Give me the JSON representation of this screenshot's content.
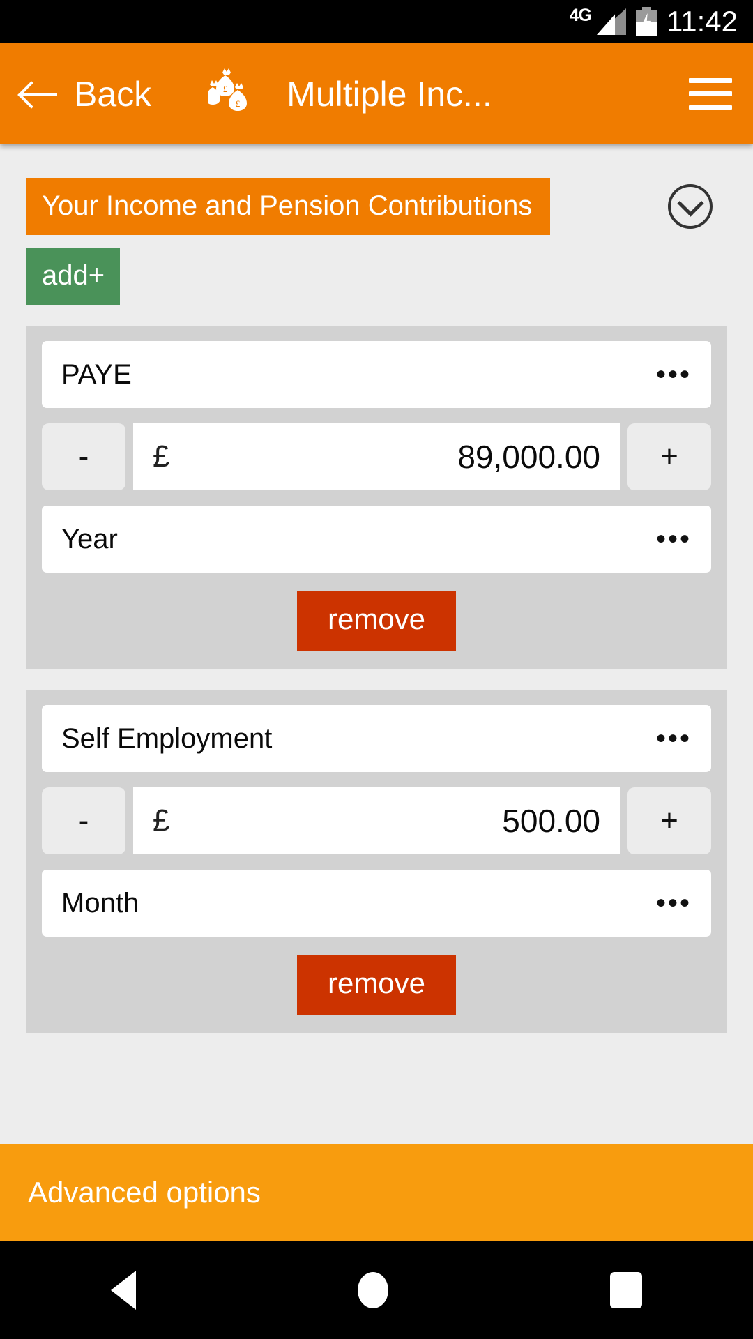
{
  "status_bar": {
    "network": "4G",
    "time": "11:42",
    "signal_icon": "signal-bars-icon",
    "battery_icon": "battery-charging-icon"
  },
  "app_bar": {
    "back_label": "Back",
    "back_icon": "arrow-left-icon",
    "title_icon": "money-bags-icon",
    "title": "Multiple Inc...",
    "menu_icon": "hamburger-menu-icon"
  },
  "section": {
    "title": "Your Income and Pension Contributions",
    "expand_icon": "chevron-down-circle-icon",
    "add_label": "add+"
  },
  "cards": [
    {
      "type_value": "PAYE",
      "type_more_icon": "ellipsis-icon",
      "decrement_label": "-",
      "increment_label": "+",
      "currency_symbol": "£",
      "amount": "89,000.00",
      "period_value": "Year",
      "period_more_icon": "ellipsis-icon",
      "remove_label": "remove"
    },
    {
      "type_value": "Self Employment",
      "type_more_icon": "ellipsis-icon",
      "decrement_label": "-",
      "increment_label": "+",
      "currency_symbol": "£",
      "amount": "500.00",
      "period_value": "Month",
      "period_more_icon": "ellipsis-icon",
      "remove_label": "remove"
    }
  ],
  "footer": {
    "advanced_label": "Advanced options"
  },
  "nav_bar": {
    "back_icon": "nav-back-triangle-icon",
    "home_icon": "nav-home-circle-icon",
    "recents_icon": "nav-recents-square-icon"
  },
  "colors": {
    "appbar_orange": "#f07c00",
    "footer_orange": "#f89c0e",
    "add_green": "#4a9259",
    "remove_red": "#cc3300",
    "card_gray": "#d2d2d2",
    "page_gray": "#ededed"
  }
}
